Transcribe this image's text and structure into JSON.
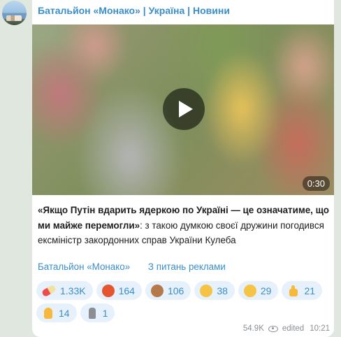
{
  "channel": {
    "title": "Батальйон «Монако» | Україна | Новини"
  },
  "video": {
    "duration": "0:30"
  },
  "post": {
    "bold_text": "«Якщо Путін вдарить ядеркою по Україні — це означатиме, що ми майже перемогли»",
    "rest_text": ": з такою думкою своєї дружини погодився ексміністр закордонних справ України Кулеба"
  },
  "links": {
    "channel_link": "Батальйон «Монако»",
    "ads_link": "З питань реклами"
  },
  "reactions": [
    {
      "icon": "pill-emoji-icon",
      "count": "1.33K"
    },
    {
      "icon": "angry-face-emoji-icon",
      "count": "164"
    },
    {
      "icon": "see-no-evil-monkey-emoji-icon",
      "count": "106"
    },
    {
      "icon": "smirk-face-emoji-icon",
      "count": "38"
    },
    {
      "icon": "thinking-face-emoji-icon",
      "count": "29"
    },
    {
      "icon": "thumbs-up-emoji-icon",
      "count": "21"
    },
    {
      "icon": "praying-hands-emoji-icon",
      "count": "14"
    },
    {
      "icon": "moai-emoji-icon",
      "count": "1"
    }
  ],
  "meta": {
    "views": "54.9K",
    "edited_label": "edited",
    "time": "10:21"
  },
  "colors": {
    "accent": "#3a8ec9",
    "reaction_bg": "#e7f1fb",
    "chat_bg": "#dfe7df"
  }
}
